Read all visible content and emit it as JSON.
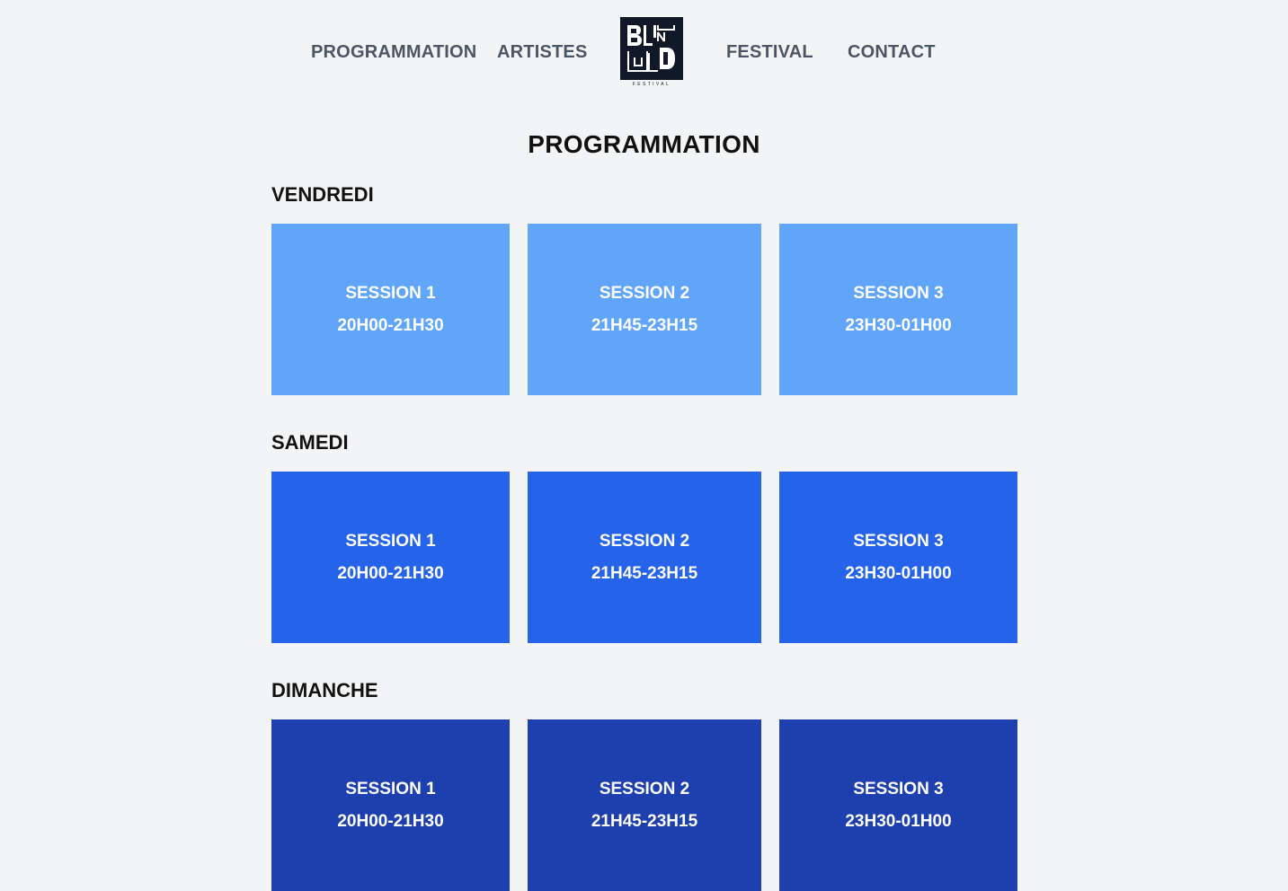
{
  "nav": {
    "links": [
      "PROGRAMMATION",
      "ARTISTES",
      "FESTIVAL",
      "CONTACT"
    ],
    "logo_text": "FESTIVAL"
  },
  "page_title": "PROGRAMMATION",
  "days": [
    {
      "name": "VENDREDI",
      "color": "#60a5fa",
      "sessions": [
        {
          "label": "SESSION 1",
          "time": "20H00-21H30"
        },
        {
          "label": "SESSION 2",
          "time": "21H45-23H15"
        },
        {
          "label": "SESSION 3",
          "time": "23H30-01H00"
        }
      ]
    },
    {
      "name": "SAMEDI",
      "color": "#2563eb",
      "sessions": [
        {
          "label": "SESSION 1",
          "time": "20H00-21H30"
        },
        {
          "label": "SESSION 2",
          "time": "21H45-23H15"
        },
        {
          "label": "SESSION 3",
          "time": "23H30-01H00"
        }
      ]
    },
    {
      "name": "DIMANCHE",
      "color": "#1e40af",
      "sessions": [
        {
          "label": "SESSION 1",
          "time": "20H00-21H30"
        },
        {
          "label": "SESSION 2",
          "time": "21H45-23H15"
        },
        {
          "label": "SESSION 3",
          "time": "23H30-01H00"
        }
      ]
    }
  ]
}
